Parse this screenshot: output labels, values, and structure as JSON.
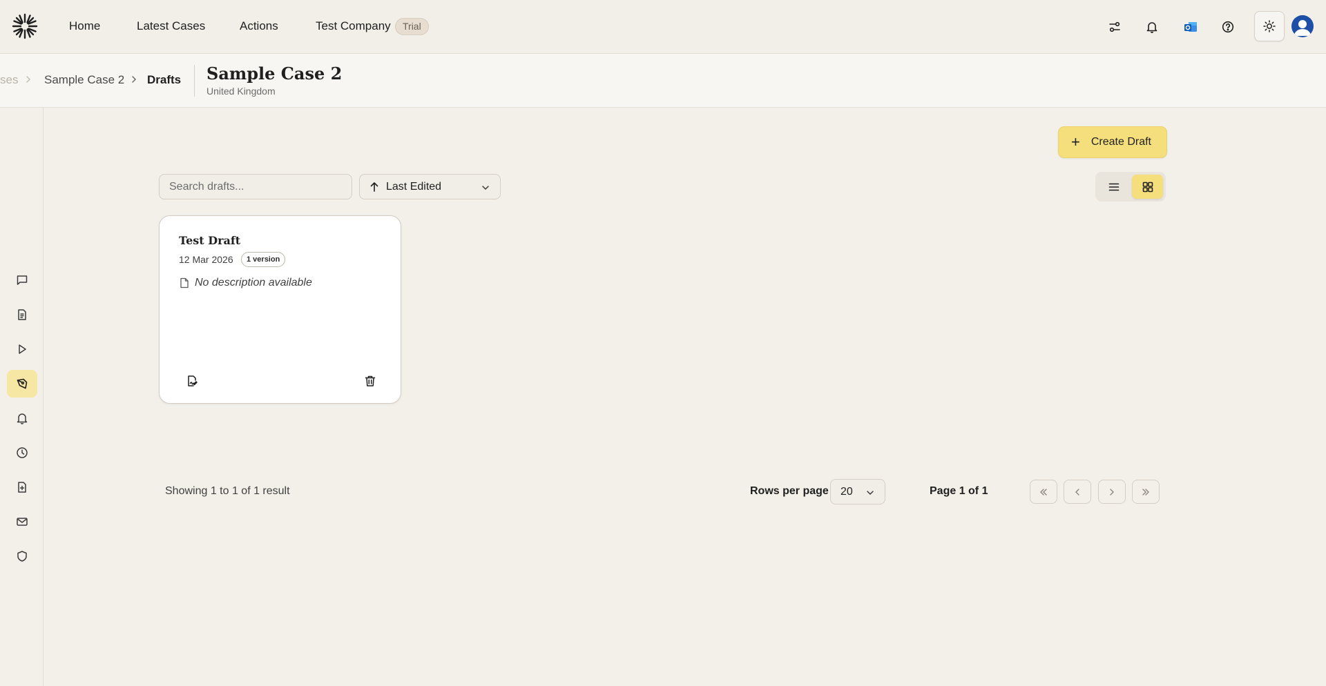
{
  "nav": {
    "items": [
      {
        "label": "Home"
      },
      {
        "label": "Latest Cases"
      },
      {
        "label": "Actions"
      },
      {
        "label": "Test Company"
      }
    ],
    "trial_badge": "Trial"
  },
  "breadcrumb": {
    "parent_fragment": "ses",
    "case": "Sample Case 2",
    "current": "Drafts"
  },
  "case": {
    "title": "Sample Case 2",
    "subtitle": "United Kingdom"
  },
  "toolbar": {
    "create_label": "Create Draft",
    "search_placeholder": "Search drafts...",
    "sort_label": "Last Edited"
  },
  "drafts": [
    {
      "title": "Test Draft",
      "date": "12 Mar 2026",
      "version_badge": "1 version",
      "description": "No description available"
    }
  ],
  "pagination": {
    "showing": "Showing 1 to 1 of 1 result",
    "rows_label": "Rows per page",
    "rows_value": "20",
    "page_label": "Page 1 of 1"
  },
  "colors": {
    "accent": "#f5df7d",
    "background": "#f3f0ea",
    "card": "#ffffff",
    "avatar": "#1d4fa7"
  }
}
